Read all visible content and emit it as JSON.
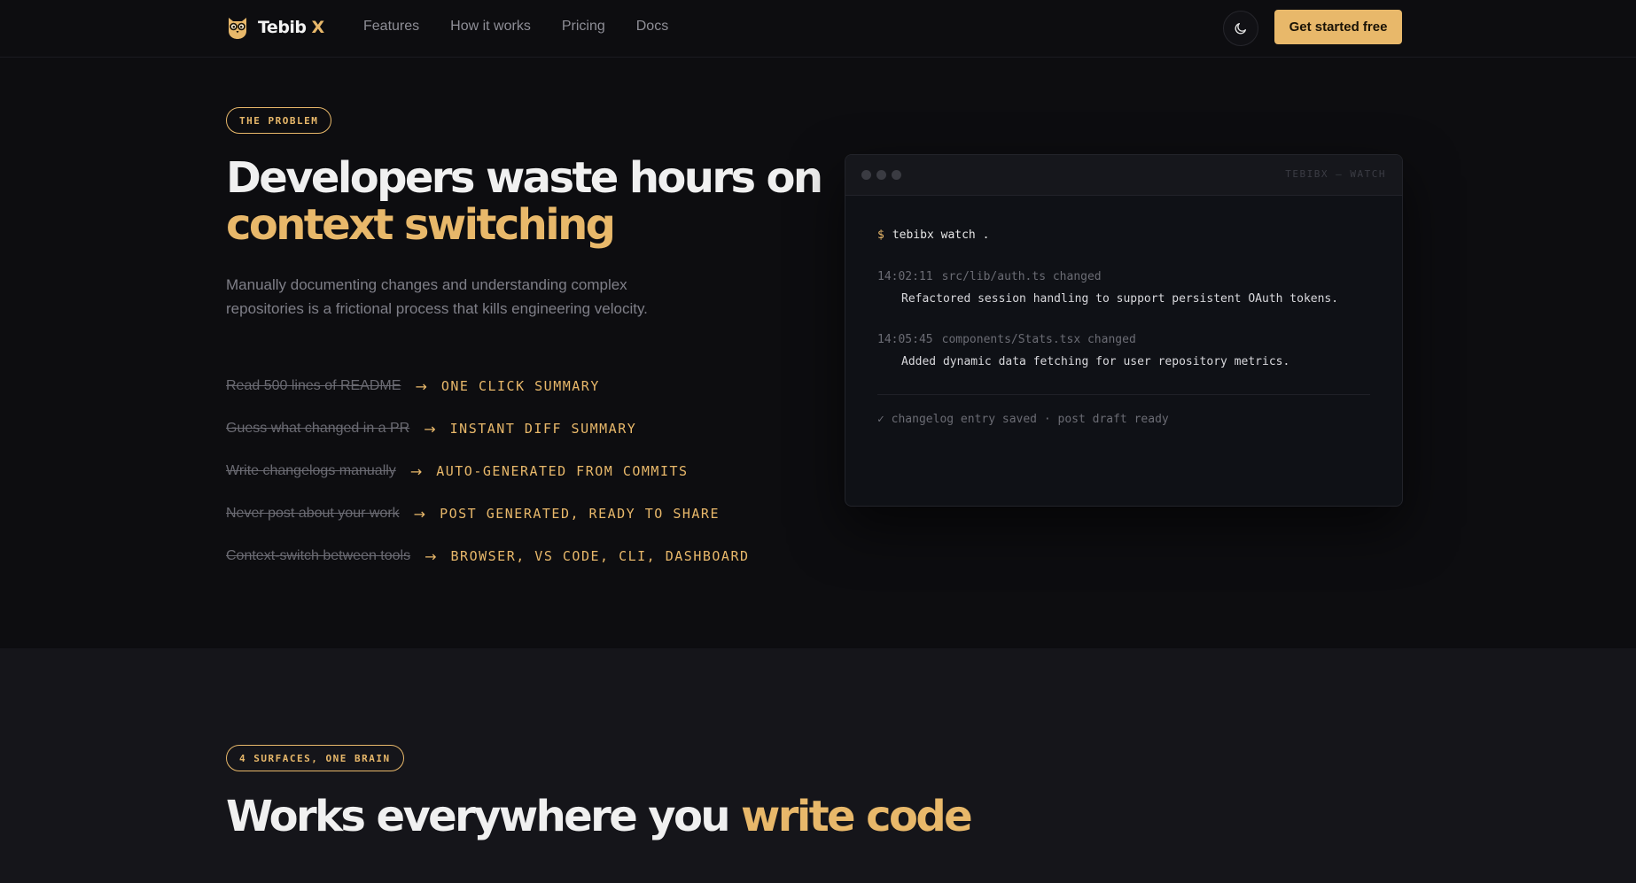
{
  "brand": {
    "name": "Tebib",
    "suffix": "X",
    "logo_icon": "owl-logo-icon"
  },
  "nav": {
    "links": [
      "Features",
      "How it works",
      "Pricing",
      "Docs"
    ],
    "theme_toggle_icon": "moon-icon",
    "cta_label": "Get started free"
  },
  "colors": {
    "accent": "#e8b86a",
    "background": "#0d0d10",
    "section_alt_background": "#15151a",
    "muted_text": "#7f7f88"
  },
  "problem": {
    "badge": "THE PROBLEM",
    "headline_plain": "Developers waste hours on",
    "headline_accent": "context switching",
    "lede": "Manually documenting changes and understanding complex repositories is a frictional process that kills engineering velocity.",
    "comparisons": [
      {
        "old": "Read 500 lines of README",
        "new": "ONE CLICK SUMMARY"
      },
      {
        "old": "Guess what changed in a PR",
        "new": "INSTANT DIFF SUMMARY"
      },
      {
        "old": "Write changelogs manually",
        "new": "AUTO-GENERATED FROM COMMITS"
      },
      {
        "old": "Never post about your work",
        "new": "POST GENERATED, READY TO SHARE"
      },
      {
        "old": "Context-switch between tools",
        "new": "BROWSER, VS CODE, CLI, DASHBOARD"
      }
    ]
  },
  "terminal": {
    "title": "TEBIBX — WATCH",
    "prompt": "$",
    "command": "tebibx watch .",
    "entries": [
      {
        "time": "14:02:11",
        "file_event": "src/lib/auth.ts changed",
        "message": "Refactored session handling to support persistent OAuth tokens."
      },
      {
        "time": "14:05:45",
        "file_event": "components/Stats.tsx changed",
        "message": "Added dynamic data fetching for user repository metrics."
      }
    ],
    "status": "✓ changelog entry saved · post draft ready"
  },
  "surfaces": {
    "badge": "4 SURFACES, ONE BRAIN",
    "headline_plain": "Works everywhere you",
    "headline_accent": "write code"
  }
}
